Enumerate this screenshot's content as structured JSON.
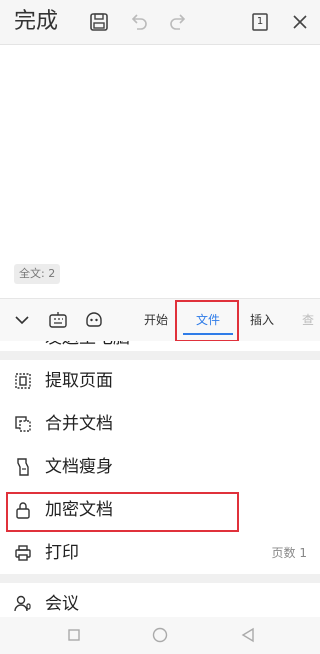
{
  "top_bar": {
    "done_label": "完成",
    "page_count_badge": "1",
    "icons": [
      "save-icon",
      "undo-icon",
      "redo-icon",
      "page-view-icon",
      "close-icon"
    ]
  },
  "document": {
    "word_count": "全文: 2"
  },
  "toolbar": {
    "tabs": [
      {
        "label": "开始"
      },
      {
        "label": "文件"
      },
      {
        "label": "插入"
      },
      {
        "label": "查"
      }
    ],
    "active_tab": "文件"
  },
  "file_menu": {
    "partial_item": "发送至电脑",
    "items": [
      {
        "label": "提取页面",
        "icon": "extract-pages-icon"
      },
      {
        "label": "合并文档",
        "icon": "merge-documents-icon"
      },
      {
        "label": "文档瘦身",
        "icon": "slim-document-icon"
      },
      {
        "label": "加密文档",
        "icon": "lock-icon"
      },
      {
        "label": "打印",
        "icon": "printer-icon",
        "extra": "页数 1"
      },
      {
        "label": "会议",
        "icon": "meeting-icon"
      }
    ]
  },
  "colors": {
    "accent": "#2f7ce8",
    "highlight": "#e0313b"
  }
}
